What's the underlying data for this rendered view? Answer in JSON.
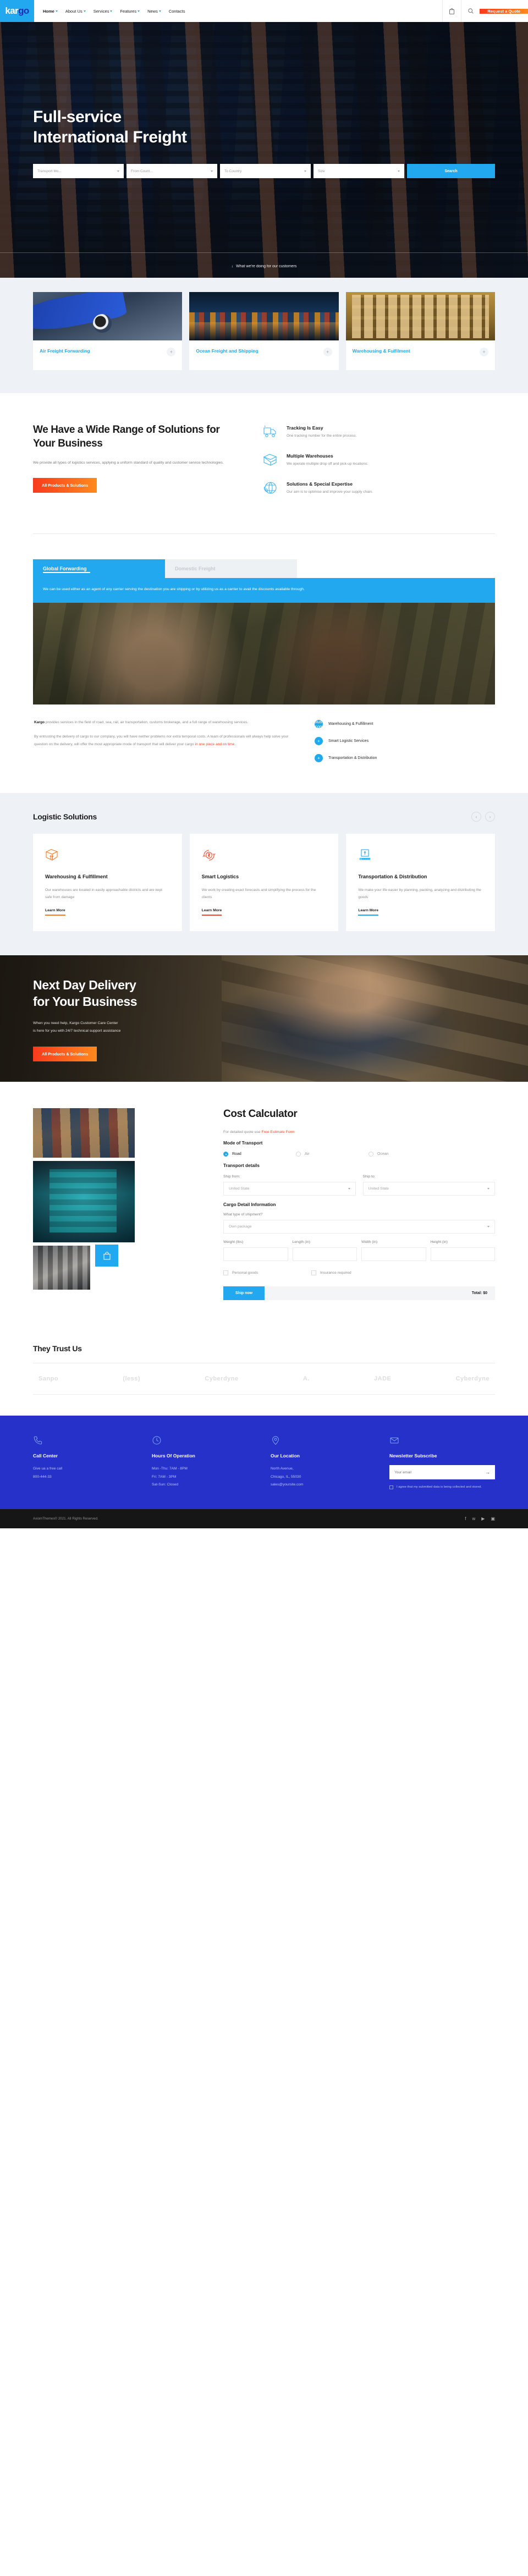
{
  "header": {
    "logo": "kargo",
    "logo_part1": "kar",
    "logo_part2": "go",
    "nav": [
      {
        "label": "Home",
        "caret": true
      },
      {
        "label": "About Us",
        "caret": true
      },
      {
        "label": "Services",
        "caret": true
      },
      {
        "label": "Features",
        "caret": true
      },
      {
        "label": "News",
        "caret": true
      },
      {
        "label": "Contacts",
        "caret": false
      }
    ],
    "cart_icon": "cart-icon",
    "search_icon": "search-icon",
    "quote_button": "Request a Quote"
  },
  "hero": {
    "title_line1": "Full-service",
    "title_line2": "International Freight",
    "form": {
      "transport_mode": "Transport Mo...",
      "from_country": "From Count...",
      "to_country": "To Country",
      "size": "Size",
      "submit": "Search"
    },
    "scroll_hint": "What we're doing for our customers"
  },
  "services": [
    {
      "title": "Air Freight Forwarding",
      "image": "airplane-photo",
      "plus": "+"
    },
    {
      "title": "Ocean Freight and Shipping",
      "image": "port-night-photo",
      "plus": "+"
    },
    {
      "title": "Warehousing & Fulfilment",
      "image": "warehouse-photo",
      "plus": "+"
    }
  ],
  "range": {
    "heading": "We Have a Wide Range of Solutions for Your Business",
    "paragraph": "We provide all types of logistics services, applying a uniform standard of quality and customer service technologies.",
    "button": "All Products & Solutions",
    "features": [
      {
        "icon": "truck-icon",
        "title": "Tracking Is Easy",
        "desc": "One tracking number for the entire process."
      },
      {
        "icon": "box-icon",
        "title": "Multiple Warehouses",
        "desc": "We operate multiple drop off and pick-up locations."
      },
      {
        "icon": "globe-support-icon",
        "title": "Solutions & Special Expertise",
        "desc": "Our aim is to optimise and improve your supply chain."
      }
    ]
  },
  "tabs": {
    "items": [
      {
        "label": "Global Forwarding",
        "active": true
      },
      {
        "label": "Domestic Freight",
        "active": false
      }
    ],
    "panel_text": "We can be used either as an agent of any carrier serving the destination you are shipping or by utilizing us as a carrier to avail the discounts available through.",
    "image": "cafe-couple-photo",
    "body_brand": "Kargo",
    "body_p1": " provides services in the field of road, sea, rail, air transportation, customs brokerage, and a full range of warehousing services.",
    "body_p2a": "By entrusting the delivery of cargo to our company, you will have neither problems nor extra temporal costs. A team of professionals will always help solve your question on the delivery, will offer the most appropriate mode of transport that will deliver your cargo ",
    "body_p2b": "in one piece and on time.",
    "bullets": [
      {
        "icon": "plus-icon",
        "label": "Warehousing & Fulfillment"
      },
      {
        "icon": "plus-icon",
        "label": "Smart Logistic Services"
      },
      {
        "icon": "plus-icon",
        "label": "Transportation & Distribution"
      }
    ]
  },
  "solutions": {
    "heading": "Logistic Solutions",
    "prev": "‹",
    "next": "›",
    "cards": [
      {
        "icon": "box-arrows-up-icon",
        "title": "Warehousing & Fulfillment",
        "desc": "Our warehouses are located in easily approachable districts and are kept safe from damage",
        "link": "Learn More",
        "accent": "#ff7a21"
      },
      {
        "icon": "money-cycle-icon",
        "title": "Smart Logistics",
        "desc": "We work by creating exact forecasts and simplifying the process for the clients",
        "link": "Learn More",
        "accent": "#f8482c"
      },
      {
        "icon": "conveyor-icon",
        "title": "Transportation & Distribution",
        "desc": "We make your life easier by planning, packing, analyzing and distributing the goods",
        "link": "Learn More",
        "accent": "#21A8EE"
      }
    ]
  },
  "nextday": {
    "title_line1": "Next Day Delivery",
    "title_line2": "for Your Business",
    "desc_line1": "When you need help, Kargo Customer Care Center",
    "desc_line2": "is here for you with 24/7 technical support assistance",
    "button": "All Products & Solutions"
  },
  "calculator": {
    "heading": "Cost Calculator",
    "note_prefix": "For detailed quote use ",
    "note_link": "Free Estimate Form",
    "mode_label": "Mode of Transport",
    "modes": [
      {
        "label": "Road",
        "selected": true
      },
      {
        "label": "Air",
        "selected": false
      },
      {
        "label": "Ocean",
        "selected": false
      }
    ],
    "transport_label": "Transport details",
    "ship_from_label": "Ship from:",
    "ship_from_value": "United State",
    "ship_to_label": "Ship to:",
    "ship_to_value": "United State",
    "cargo_label": "Cargo Detail Information",
    "shipment_type_label": "What type of shipment?",
    "shipment_type_value": "Own package",
    "dims": [
      {
        "label": "Weight (lbs)",
        "value": ""
      },
      {
        "label": "Length (in)",
        "value": ""
      },
      {
        "label": "Width (in)",
        "value": ""
      },
      {
        "label": "Height (in)",
        "value": ""
      }
    ],
    "checks": [
      {
        "label": "Personal goods"
      },
      {
        "label": "Insurance required"
      }
    ],
    "submit": "Ship now",
    "total": "Total: $0",
    "gallery": [
      "containers-yard-photo",
      "teal-ship-aerial-photo",
      "warehouse-aisle-photo"
    ],
    "badge_icon": "cart-icon"
  },
  "trust": {
    "heading": "They Trust Us",
    "logos": [
      "Sanpo",
      "(less)",
      "Cyberdyne",
      "A.",
      "JADE",
      "Cyberdyne"
    ]
  },
  "footer": {
    "columns": [
      {
        "icon": "phone-icon",
        "title": "Call Center",
        "lines": [
          "Give ua a free call",
          "800-444-33"
        ]
      },
      {
        "icon": "clock-icon",
        "title": "Hours Of Operation",
        "lines": [
          "Mon -Thu: 7AM - 8PM",
          "Fri: 7AM - 3PM",
          "Sat-Sun: Closed"
        ]
      },
      {
        "icon": "pin-icon",
        "title": "Our Location",
        "lines": [
          "North Avenue,",
          "Chicago, IL, 55030",
          "sales@yoursite.com"
        ]
      }
    ],
    "newsletter": {
      "icon": "mail-icon",
      "title": "Newsletter Subscribe",
      "placeholder": "Your email",
      "arrow": "→",
      "agree": "I agree that my submitted data is being collected and stored."
    },
    "copyright": "AxiomThemes© 2021. All Rights Reserved.",
    "socials": [
      "facebook-icon",
      "twitter-icon",
      "youtube-icon",
      "instagram-icon"
    ]
  },
  "colors": {
    "brand_blue": "#21A8EE",
    "brand_orange": "#ff7a21",
    "brand_red": "#f8482c",
    "footer_blue": "#2531c9"
  }
}
